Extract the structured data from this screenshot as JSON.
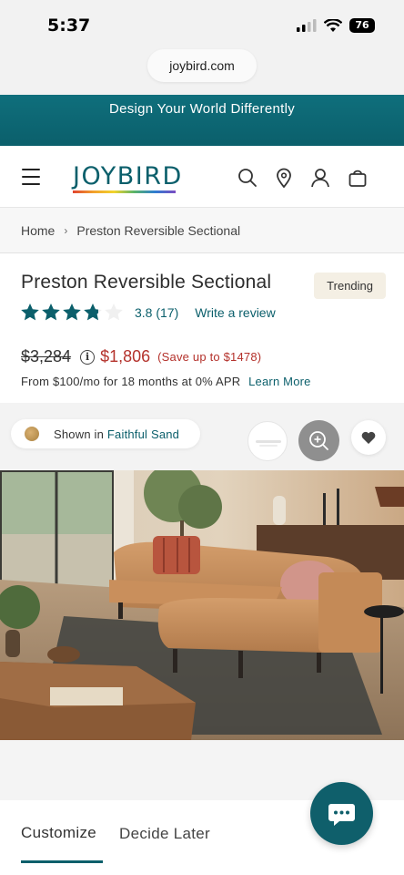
{
  "status_bar": {
    "time": "5:37",
    "battery": "76"
  },
  "browser": {
    "url": "joybird.com"
  },
  "promo": {
    "text": "Design Your World Differently"
  },
  "header": {
    "logo": "JOYBIRD"
  },
  "breadcrumb": {
    "home": "Home",
    "separator": "›",
    "current": "Preston Reversible Sectional"
  },
  "product": {
    "title": "Preston Reversible Sectional",
    "badge": "Trending",
    "rating": 3.8,
    "rating_display": "3.8",
    "review_count": "(17)",
    "write_review": "Write a review",
    "original_price": "$3,284",
    "info_symbol": "i",
    "sale_price": "$1,806",
    "savings": "(Save up to $1478)",
    "financing": "From $100/mo for 18 months at 0% APR",
    "learn_more": "Learn More"
  },
  "gallery": {
    "shown_prefix": "Shown in",
    "fabric": "Faithful Sand"
  },
  "tabs": [
    {
      "label": "Customize",
      "active": true
    },
    {
      "label": "Decide Later",
      "active": false
    }
  ],
  "colors": {
    "brand_teal": "#0b5f6b",
    "sale_red": "#b4322c",
    "badge_bg": "#f4efe4"
  },
  "icons": [
    "hamburger-menu-icon",
    "search-icon",
    "location-pin-icon",
    "account-icon",
    "cart-icon",
    "info-icon",
    "zoom-in-icon",
    "heart-icon",
    "chat-icon",
    "star-icon"
  ]
}
